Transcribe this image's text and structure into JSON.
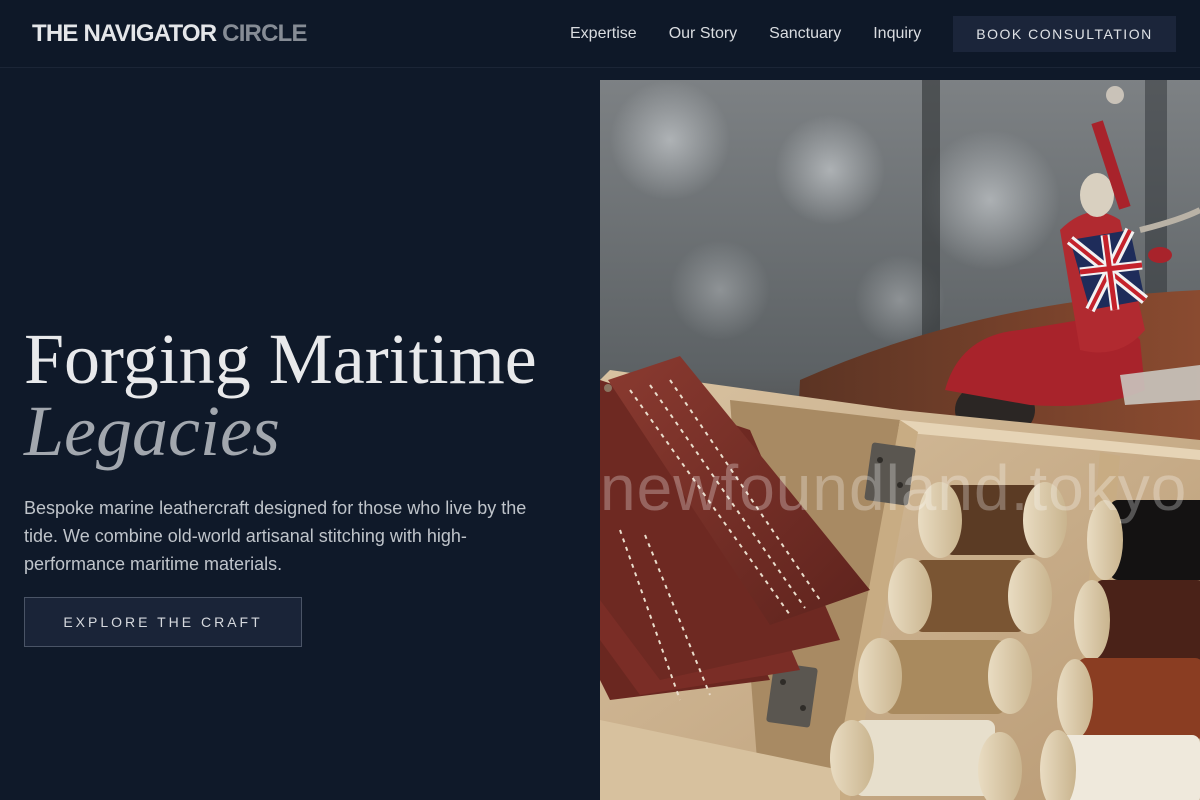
{
  "header": {
    "brand_main": "THE NAVIGATOR",
    "brand_accent": "CIRCLE",
    "nav": [
      "Expertise",
      "Our Story",
      "Sanctuary",
      "Inquiry"
    ],
    "cta_label": "BOOK CONSULTATION"
  },
  "hero": {
    "title_line1": "Forging Maritime",
    "title_line2": "Legacies",
    "subtitle": "Bespoke marine leathercraft designed for those who live by the tide. We combine old-world artisanal stitching with high-performance maritime materials.",
    "cta_label": "EXPLORE THE CRAFT",
    "image": {
      "watermark": "newfoundland.tokyo"
    }
  },
  "colors": {
    "background": "#0f1929",
    "header_bg": "#0e1828",
    "button_bg": "#1b253a",
    "text_primary": "#e8e9eb",
    "text_muted": "#a2a7ae",
    "leather": "#7a2d26",
    "scooter_red": "#a8232b"
  }
}
